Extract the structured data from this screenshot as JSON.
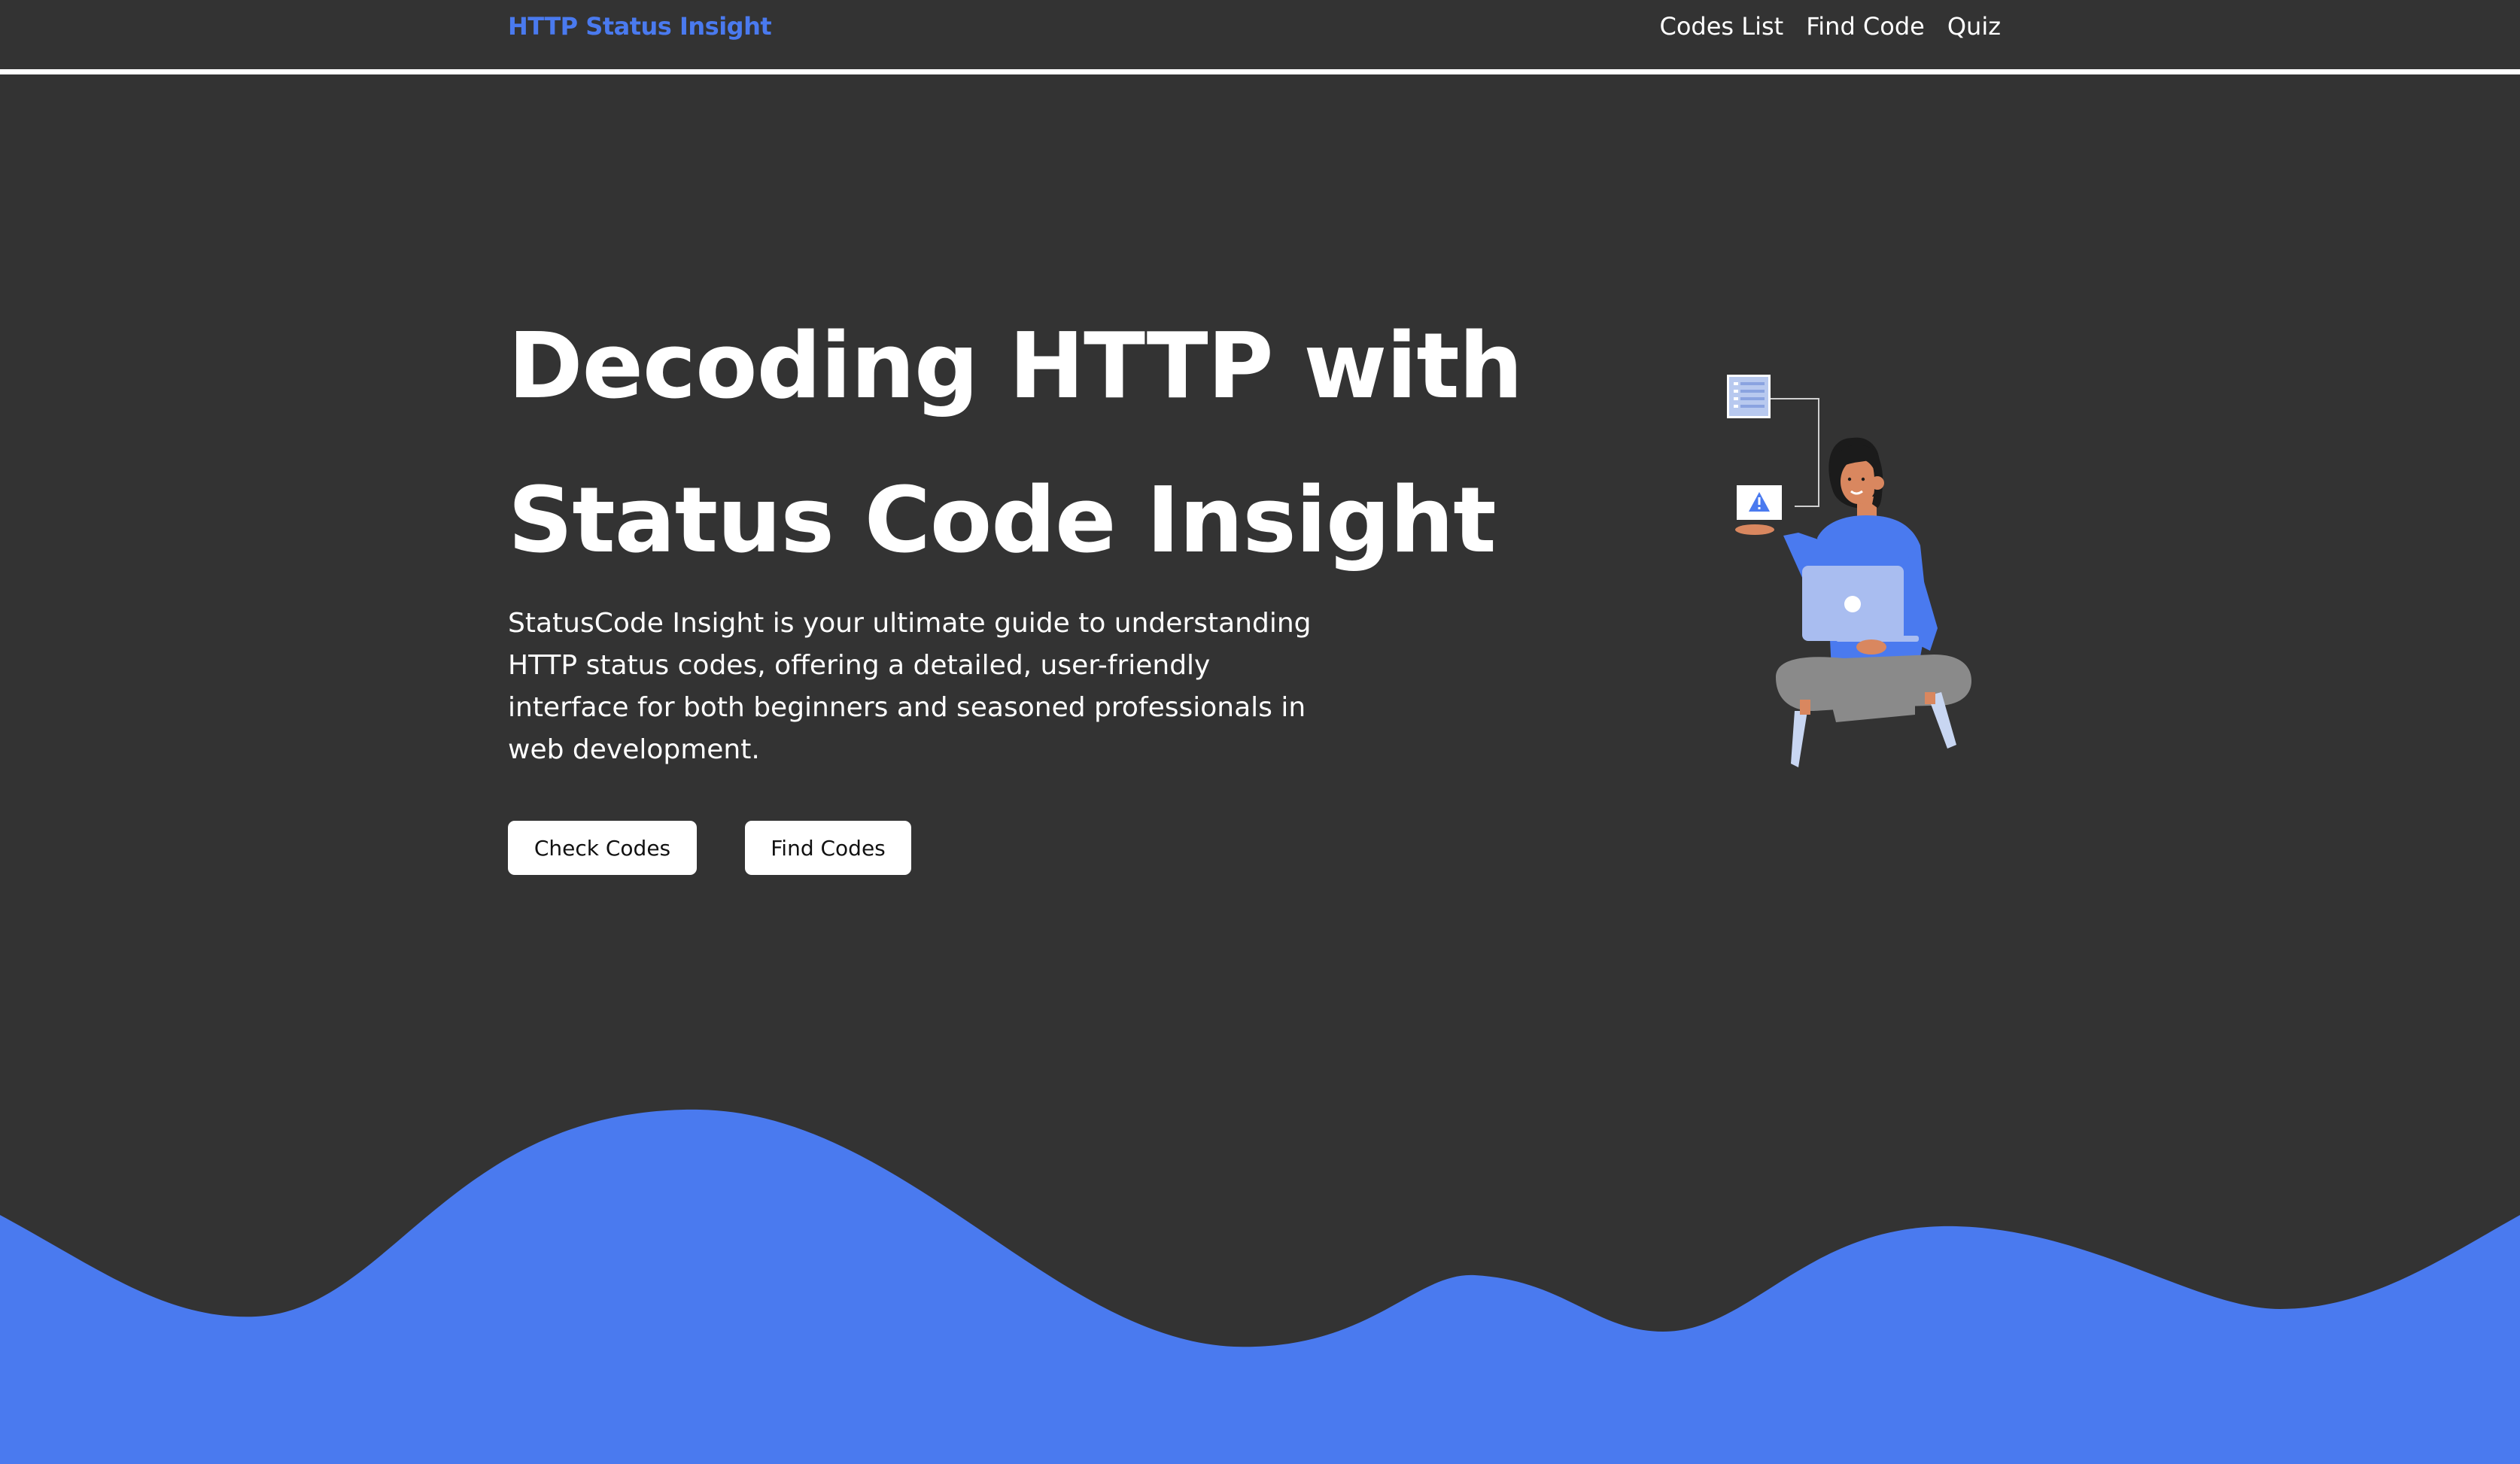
{
  "header": {
    "brand": "HTTP Status Insight",
    "nav": [
      "Codes List",
      "Find Code",
      "Quiz"
    ]
  },
  "hero": {
    "title_line1": "Decoding HTTP with",
    "title_line2": "Status Code Insight",
    "description": "StatusCode Insight is your ultimate guide to understanding HTTP status codes, offering a detailed, user-friendly interface for both beginners and seasoned professionals in web development.",
    "buttons": {
      "check": "Check Codes",
      "find": "Find Codes"
    }
  },
  "illustration": {
    "icons": [
      "document-list-icon",
      "warning-icon"
    ]
  },
  "colors": {
    "background": "#333333",
    "accent": "#4a7aef",
    "text": "#ffffff",
    "button_bg": "#ffffff",
    "button_text": "#111111"
  }
}
